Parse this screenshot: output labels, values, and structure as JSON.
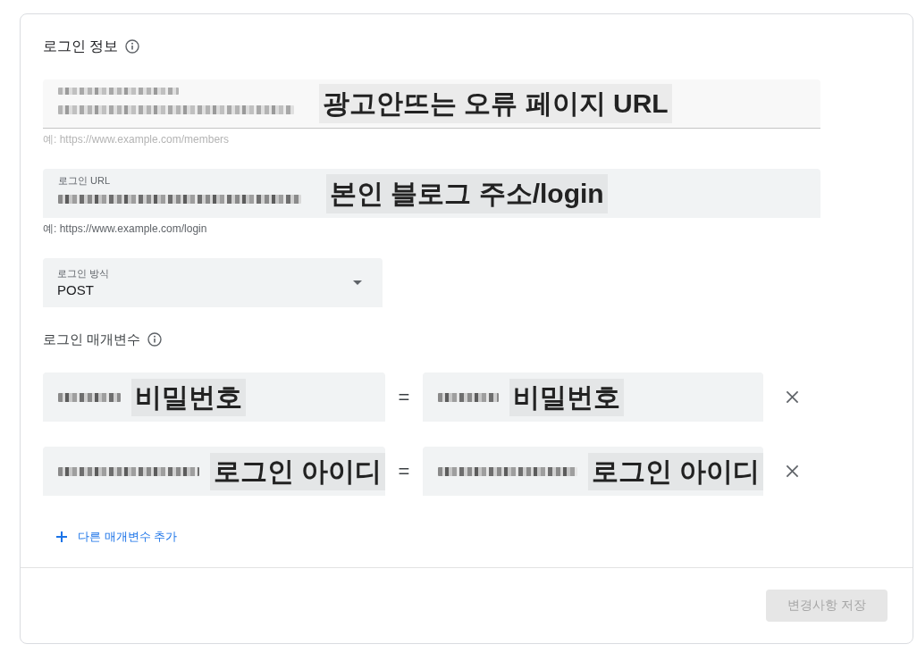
{
  "login_info": {
    "title": "로그인 정보",
    "fields": [
      {
        "kind": "text",
        "label_redacted": true,
        "value_redacted": true,
        "disabled": true,
        "annotation": "광고안뜨는 오류 페이지 URL",
        "helper": "예: https://www.example.com/members"
      },
      {
        "kind": "text",
        "label": "로그인 URL",
        "value_redacted": true,
        "disabled": false,
        "annotation": "본인 블로그 주소/login",
        "helper": "예: https://www.example.com/login"
      },
      {
        "kind": "select",
        "label": "로그인 방식",
        "value": "POST",
        "disabled": false
      }
    ]
  },
  "login_parameters": {
    "title": "로그인 매개변수",
    "rows": [
      {
        "name": {
          "value_redacted": true,
          "annotation": "비밀번호"
        },
        "separator": "=",
        "value": {
          "value_redacted": true,
          "annotation": "비밀번호"
        }
      },
      {
        "name": {
          "value_redacted": true,
          "annotation": "로그인 아이디"
        },
        "separator": "=",
        "value": {
          "value_redacted": true,
          "annotation": "로그인 아이디"
        }
      }
    ],
    "add_button": {
      "label": "다른 매개변수 추가"
    }
  },
  "save_button": {
    "label": "변경사항 저장",
    "disabled": true
  }
}
